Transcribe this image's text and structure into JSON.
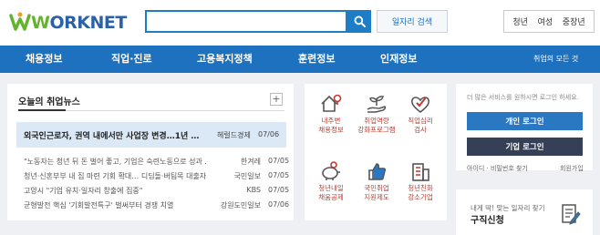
{
  "header": {
    "logo": "WORKNET",
    "job_search_button": "일자리 검색",
    "user_tabs": [
      "청년",
      "여성",
      "중장년"
    ]
  },
  "nav": {
    "items": [
      "채용정보",
      "직업·진로",
      "고용복지정책",
      "훈련정보",
      "인재정보"
    ],
    "all_services": "취업의 모든 것"
  },
  "news": {
    "title": "오늘의 취업뉴스",
    "plus": "+",
    "highlight": {
      "title": "외국인근로자, 권역 내에서만 사업장 변경…1년 …",
      "source": "헤럴드경제",
      "date": "07/06"
    },
    "rows": [
      {
        "title": "\"노동자는 청년 뒤 돈 벌어 좋고, 기업은 숙련노동으로 성과 …",
        "source": "한겨레",
        "date": "07/05"
      },
      {
        "title": "청년·신혼부부 내 집 마련 기회 확대… 디딤돌·버팀목 대출자…",
        "source": "국민일보",
        "date": "07/05"
      },
      {
        "title": "고양시 \"기업 유치·일자리 창출에 집중\"",
        "source": "KBS",
        "date": "07/05"
      },
      {
        "title": "균형발전 핵심 '기회발전특구' 벌써부터 경쟁 치열",
        "source": "강원도민일보",
        "date": "07/06"
      }
    ]
  },
  "services": [
    {
      "label": "내주변\n채용정보",
      "icon": "house-map-icon"
    },
    {
      "label": "취업역량\n강화프로그램",
      "icon": "sprout-hand-icon"
    },
    {
      "label": "직업심리\n검사",
      "icon": "heart-check-icon"
    },
    {
      "label": "청년내일\n채움공제",
      "icon": "piggy-bank-icon"
    },
    {
      "label": "국민취업\n지원제도",
      "icon": "thumbs-up-icon"
    },
    {
      "label": "청년친화\n강소기업",
      "icon": "building-icon"
    }
  ],
  "login": {
    "info": "더 많은 서비스를 원하시면 로그인 하세요.",
    "personal_login": "개인 로그인",
    "company_login": "기업 로그인",
    "find_id_pw": "아이디 · 비밀번호 찾기",
    "join": "회원가입"
  },
  "job_request": {
    "subtitle": "내게 딱! 맞는 일자리 찾기",
    "title": "구직신청"
  },
  "colors": {
    "brand_blue": "#1e71be",
    "logo_green": "#64b32e",
    "company_button": "#353f55",
    "icon_red": "#c0392b"
  }
}
